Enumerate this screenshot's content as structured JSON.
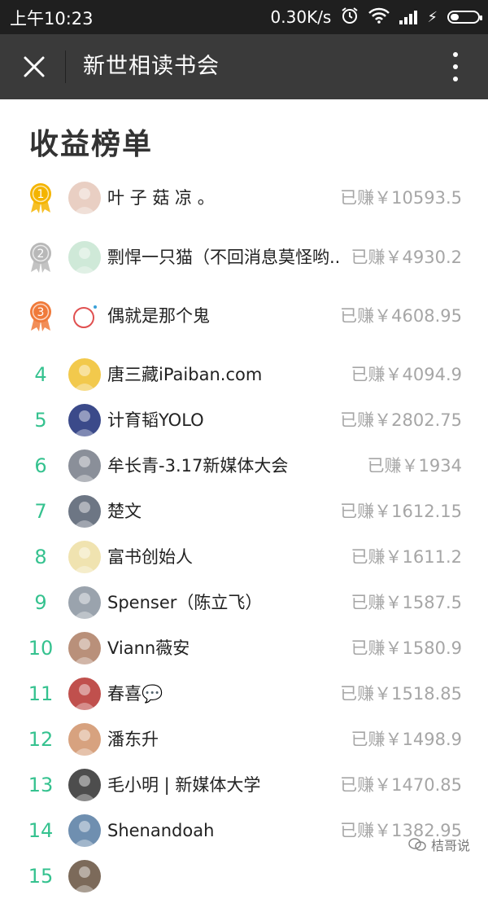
{
  "status_bar": {
    "time": "上午10:23",
    "speed": "0.30K/s"
  },
  "title_bar": {
    "close_glyph": "✕",
    "title": "新世相读书会"
  },
  "heading": "收益榜单",
  "colors": {
    "accent": "#35c28f",
    "gold": "#f4b400",
    "silver": "#b8b8b8",
    "bronze": "#f07a3a"
  },
  "rows": [
    {
      "rank": "1",
      "medal": "gold",
      "name": "叶 子 菇 凉 。",
      "earned": "已赚￥10593.5",
      "avatar": "#e9cfc3"
    },
    {
      "rank": "2",
      "medal": "silver",
      "name": "剽悍一只猫（不回消息莫怪哟..",
      "earned": "已赚￥4930.2",
      "avatar": "#cfe9d8"
    },
    {
      "rank": "3",
      "medal": "bronze",
      "name": "偶就是那个鬼",
      "earned": "已赚￥4608.95",
      "avatar": "#ffffff"
    },
    {
      "rank": "4",
      "name": "唐三藏iPaiban.com",
      "earned": "已赚￥4094.9",
      "avatar": "#f2c94c"
    },
    {
      "rank": "5",
      "name": "计育韬YOLO",
      "earned": "已赚￥2802.75",
      "avatar": "#3b4a8a"
    },
    {
      "rank": "6",
      "name": "牟长青-3.17新媒体大会",
      "earned": "已赚￥1934",
      "avatar": "#8a8f99"
    },
    {
      "rank": "7",
      "name": "楚文",
      "earned": "已赚￥1612.15",
      "avatar": "#6d7684"
    },
    {
      "rank": "8",
      "name": "富书创始人",
      "earned": "已赚￥1611.2",
      "avatar": "#f0e3b0"
    },
    {
      "rank": "9",
      "name": "Spenser（陈立飞）",
      "earned": "已赚￥1587.5",
      "avatar": "#9aa3ad"
    },
    {
      "rank": "10",
      "name": "Viann薇安",
      "earned": "已赚￥1580.9",
      "avatar": "#b9907a"
    },
    {
      "rank": "11",
      "name": "春喜💬",
      "earned": "已赚￥1518.85",
      "avatar": "#c0504d"
    },
    {
      "rank": "12",
      "name": "潘东升",
      "earned": "已赚￥1498.9",
      "avatar": "#d7a27f"
    },
    {
      "rank": "13",
      "name": "毛小明 | 新媒体大学",
      "earned": "已赚￥1470.85",
      "avatar": "#4d4d4d"
    },
    {
      "rank": "14",
      "name": "Shenandoah",
      "earned": "已赚￥1382.95",
      "avatar": "#6f8fb0"
    },
    {
      "rank": "15",
      "name": "",
      "earned": "",
      "avatar": "#7c6a5a"
    }
  ],
  "watermark": "桔哥说"
}
